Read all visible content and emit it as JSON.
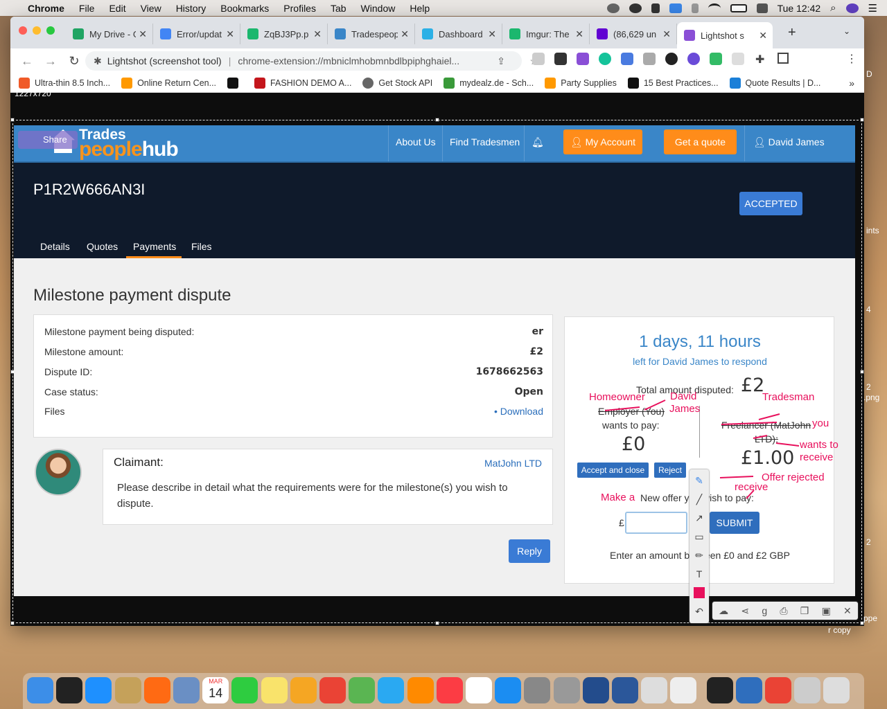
{
  "menubar": {
    "app": "Chrome",
    "items": [
      "File",
      "Edit",
      "View",
      "History",
      "Bookmarks",
      "Profiles",
      "Tab",
      "Window",
      "Help"
    ],
    "clock": "Tue 12:42"
  },
  "browser": {
    "tabs": [
      {
        "label": "My Drive - G",
        "icon": "google-drive-icon",
        "color": "#1fa463"
      },
      {
        "label": "Error/updat",
        "icon": "google-docs-icon",
        "color": "#4285f4"
      },
      {
        "label": "ZqBJ3Pp.p",
        "icon": "imgur-icon",
        "color": "#1bb76e"
      },
      {
        "label": "Tradespeop",
        "icon": "tradespeople-icon",
        "color": "#3a86c8"
      },
      {
        "label": "Dashboard",
        "icon": "dashboard-icon",
        "color": "#2bb0e6"
      },
      {
        "label": "Imgur: The",
        "icon": "imgur-icon",
        "color": "#1bb76e"
      },
      {
        "label": "(86,629 un",
        "icon": "mail-icon",
        "color": "#6001d2"
      },
      {
        "label": "Lightshot s",
        "icon": "lightshot-icon",
        "color": "#8a4fd6",
        "active": true
      }
    ],
    "omnibox": {
      "title": "Lightshot (screenshot tool)",
      "url": "chrome-extension://mbniclmhobmnbdlbpiphghaiel..."
    },
    "bookmarks": [
      {
        "label": "Ultra-thin 8.5 Inch...",
        "color": "#f05a28"
      },
      {
        "label": "Online Return Cen...",
        "color": "#ff9900"
      },
      {
        "label": "",
        "color": "#111"
      },
      {
        "label": "FASHION DEMO A...",
        "color": "#c4161c"
      },
      {
        "label": "Get Stock API",
        "color": "#666"
      },
      {
        "label": "mydealz.de - Sch...",
        "color": "#3a9a3a"
      },
      {
        "label": "Party Supplies",
        "color": "#ff9900"
      },
      {
        "label": "15 Best Practices...",
        "color": "#111"
      },
      {
        "label": "Quote Results | D...",
        "color": "#1a7fd8"
      }
    ]
  },
  "lightshot": {
    "size_label": "1227x720",
    "tool_names": [
      "pen-tool-icon",
      "line-tool-icon",
      "arrow-tool-icon",
      "rectangle-tool-icon",
      "marker-tool-icon",
      "text-tool-icon",
      "color-picker-icon",
      "undo-icon"
    ],
    "action_names": [
      "upload-icon",
      "share-icon",
      "google-search-icon",
      "print-icon",
      "copy-icon",
      "save-icon",
      "close-icon"
    ]
  },
  "site": {
    "logo_top": "Trades",
    "logo_bottom_a": "people",
    "logo_bottom_b": "hub",
    "share": "Share",
    "nav": {
      "about": "About Us",
      "find": "Find Tradesmen",
      "my_account": "My Account",
      "get_quote": "Get a quote",
      "user": "David James"
    },
    "job_id": "P1R2W666AN3I",
    "status_badge": "ACCEPTED",
    "tabs": [
      "Details",
      "Quotes",
      "Payments",
      "Files"
    ],
    "active_tab": "Payments"
  },
  "dispute": {
    "title": "Milestone payment dispute",
    "rows": [
      {
        "label": "Milestone payment being disputed:",
        "value": "er"
      },
      {
        "label": "Milestone amount:",
        "value": "£2"
      },
      {
        "label": "Dispute ID:",
        "value": "1678662563"
      },
      {
        "label": "Case status:",
        "value": "Open"
      },
      {
        "label": "Files",
        "value": "Download"
      }
    ],
    "claimant_label": "Claimant:",
    "claimant_name": "MatJohn LTD",
    "claim_text": "Please describe in detail what the requirements were for the milestone(s) you wish to dispute.",
    "reply": "Reply"
  },
  "offer": {
    "countdown": "1 days, 11 hours",
    "left_for": "left for David James to respond",
    "total_label": "Total amount disputed:",
    "total_value": "£2",
    "employer_label": "Employer (You)",
    "wants_to_pay": "wants to pay:",
    "employer_amount": "£0",
    "accept_close": "Accept and close",
    "reject": "Reject",
    "freelancer_label": "Freelancer (MatJohn",
    "freelancer_label2": "LTD):",
    "freelancer_amount": "£1.00",
    "new_offer": "New offer you wish to pay:",
    "currency": "£",
    "submit": "SUBMIT",
    "hint": "Enter an amount between £0 and £2 GBP"
  },
  "annotations": {
    "homeowner": "Homeowner",
    "david": "David",
    "james": "James",
    "tradesman": "Tradesman",
    "you": "you",
    "wants_to": "wants to",
    "receive": "receive",
    "offer_rejected": "Offer rejected",
    "receive2": "receive",
    "make_a": "Make a"
  },
  "desktop": {
    "right_edge_labels": [
      "D",
      "ints",
      "4",
      "2",
      ".png",
      "2",
      "ppe",
      "r copy"
    ]
  },
  "dock": {
    "items": [
      {
        "name": "finder-icon",
        "color": "#3c8ee8"
      },
      {
        "name": "siri-icon",
        "color": "#222"
      },
      {
        "name": "safari-icon",
        "color": "#1e90ff"
      },
      {
        "name": "notes-app-icon",
        "color": "#c5a15a"
      },
      {
        "name": "firefox-icon",
        "color": "#ff6a13"
      },
      {
        "name": "preview-icon",
        "color": "#6a8fc4"
      },
      {
        "name": "calendar-icon",
        "color": "#fff"
      },
      {
        "name": "facetime-icon",
        "color": "#2ecc40"
      },
      {
        "name": "stickies-icon",
        "color": "#f9e36b"
      },
      {
        "name": "photos-icon",
        "color": "#f5a623"
      },
      {
        "name": "chrome-icon",
        "color": "#ea4335"
      },
      {
        "name": "maps-icon",
        "color": "#5ab552"
      },
      {
        "name": "messages-icon",
        "color": "#2aa9f2"
      },
      {
        "name": "books-icon",
        "color": "#ff8a00"
      },
      {
        "name": "music-icon",
        "color": "#fc3c44"
      },
      {
        "name": "reminders-icon",
        "color": "#fff"
      },
      {
        "name": "app-store-icon",
        "color": "#1b8df2"
      },
      {
        "name": "system-preferences-icon",
        "color": "#888"
      },
      {
        "name": "launchpad-icon",
        "color": "#999"
      },
      {
        "name": "bankid-icon",
        "color": "#234c8c"
      },
      {
        "name": "word-icon",
        "color": "#2b579a"
      },
      {
        "name": "help-icon",
        "color": "#ddd"
      },
      {
        "name": "textedit-icon",
        "color": "#eee"
      },
      {
        "name": "terminal-icon",
        "color": "#222"
      },
      {
        "name": "vpn-icon",
        "color": "#2f6ebd"
      },
      {
        "name": "chrome-2-icon",
        "color": "#ea4335"
      },
      {
        "name": "screenshot-folder-icon",
        "color": "#ccc"
      },
      {
        "name": "trash-icon",
        "color": "#ddd"
      }
    ],
    "calendar_month": "MAR",
    "calendar_day": "14"
  }
}
